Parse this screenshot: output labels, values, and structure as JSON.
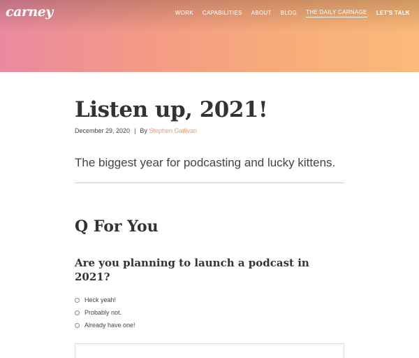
{
  "header": {
    "logo": "carney",
    "nav": [
      {
        "label": "WORK"
      },
      {
        "label": "CAPABILITIES"
      },
      {
        "label": "ABOUT"
      },
      {
        "label": "BLOG"
      },
      {
        "label": "THE DAILY CARNAGE",
        "active": true
      },
      {
        "label": "LET'S TALK",
        "cta": true
      }
    ]
  },
  "article": {
    "title": "Listen up, 2021!",
    "date": "December 29, 2020",
    "separator": "|",
    "by_label": "By",
    "author": "Stephen Gallivan",
    "subtitle": "The biggest year for podcasting and lucky kittens."
  },
  "quiz": {
    "section_title": "Q For You",
    "question": "Are you planning to launch a podcast in 2021?",
    "options": [
      "Heck yeah!",
      "Probably not.",
      "Already have one!"
    ]
  },
  "colors": {
    "gradient_left": "#e98aa0",
    "gradient_right": "#fbb97a",
    "accent": "#f0956f",
    "text": "#333333"
  }
}
